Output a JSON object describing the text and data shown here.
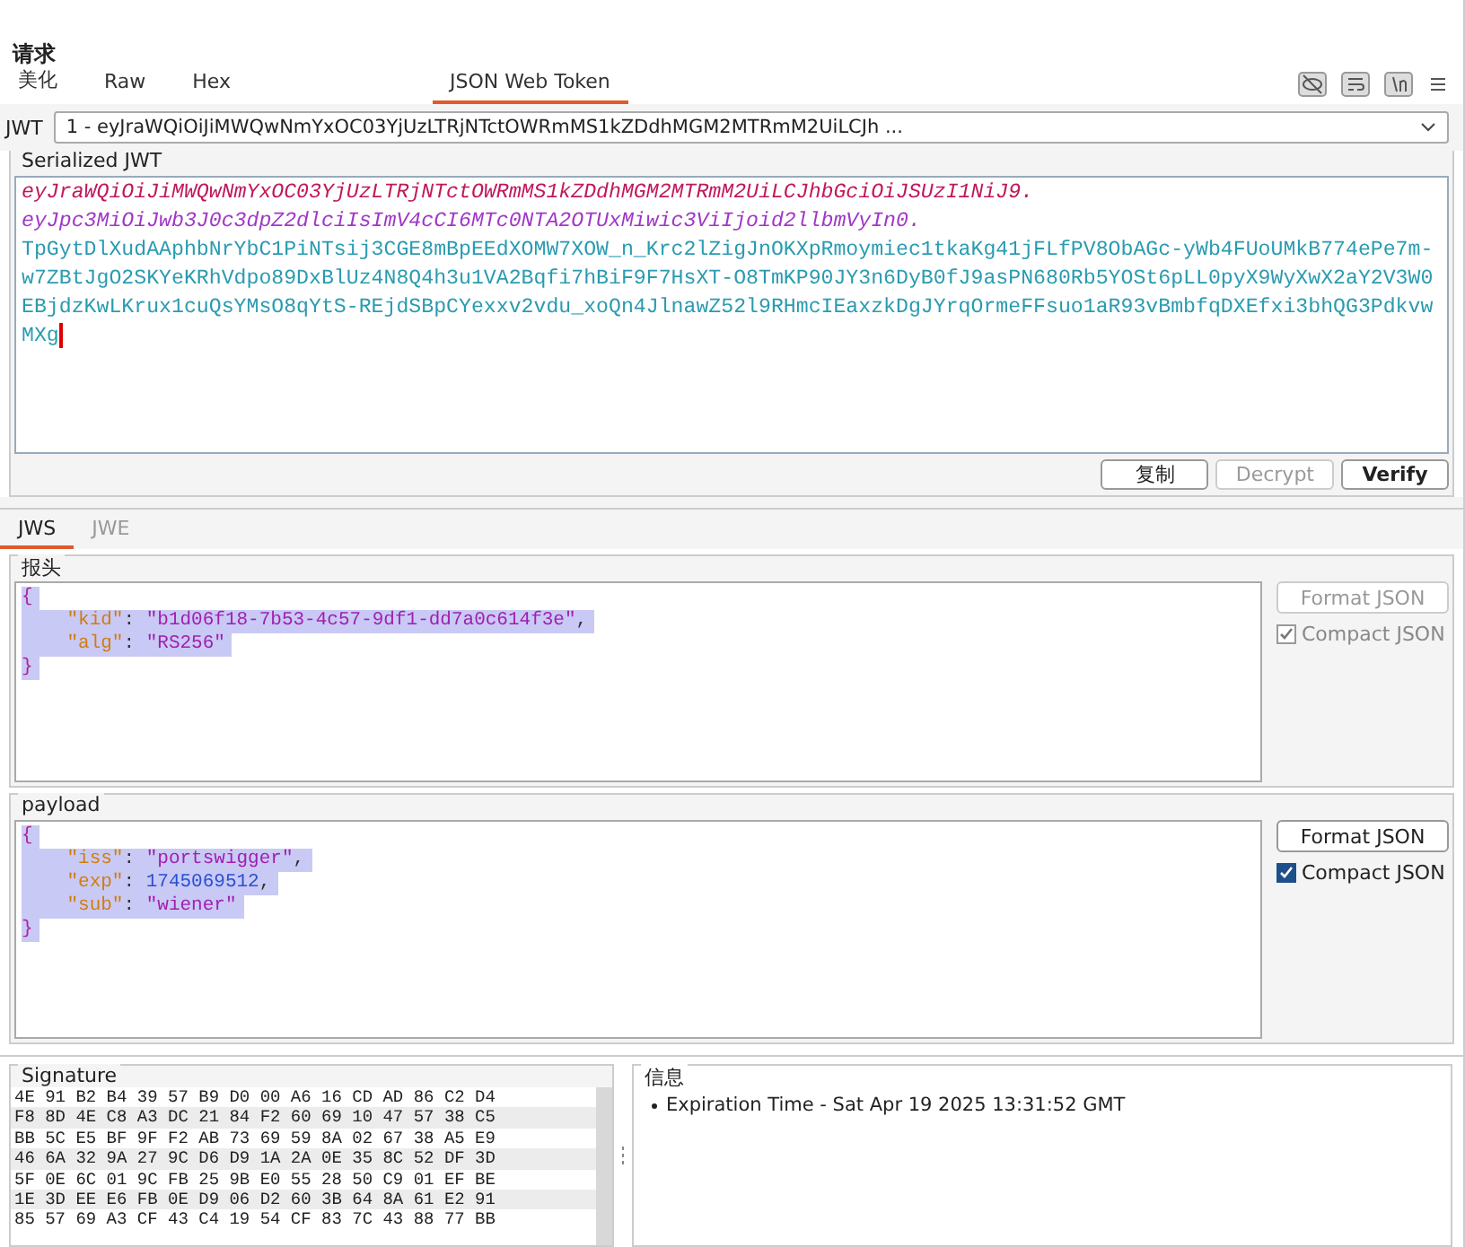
{
  "panel_title": "请求",
  "view_tabs": [
    {
      "label": "美化",
      "selected": false
    },
    {
      "label": "Raw",
      "selected": false
    },
    {
      "label": "Hex",
      "selected": false
    },
    {
      "label": "JSON Web Token",
      "selected": true
    }
  ],
  "jwt_select": {
    "label": "JWT",
    "value": "1 - eyJraWQiOiJiMWQwNmYxOC03YjUzLTRjNTctOWRmMS1kZDdhMGM2MTRmM2UiLCJh ..."
  },
  "serialized": {
    "title": "Serialized JWT",
    "parts": [
      {
        "kind": "header",
        "text": "eyJraWQiOiJiMWQwNmYxOC03YjUzLTRjNTctOWRmMS1kZDdhMGM2MTRmM2UiLCJhbGciOiJSUzI1NiJ9."
      },
      {
        "kind": "payload",
        "text": "eyJpc3MiOiJwb3J0c3dpZ2dlciIsImV4cCI6MTc0NTA2OTUxMiwic3ViIjoid2llbmVyIn0."
      },
      {
        "kind": "signature",
        "text": "TpGytDlXudAAphbNrYbC1PiNTsij3CGE8mBpEEdXOMW7XOW_n_Krc2lZigJnOKXpRmoymiec1tkaKg41jFLfPV8ObAGc-yWb4FUoUMkB774ePe7m-w7ZBtJgO2SKYeKRhVdpo89DxBlUz4N8Q4h3u1VA2Bqfi7hBiF9F7HsXT-O8TmKP90JY3n6DyB0fJ9asPN680Rb5YOSt6pLL0pyX9WyXwX2aY2V3W0EBjdzKwLKrux1cuQsYMsO8qYtS-REjdSBpCYexxv2vdu_xoQn4JlnawZ52l9RHmcIEaxzkDgJYrqOrmeFFsuo1aR93vBmbfqDXEfxi3bhQG3PdkvwMXg"
      }
    ],
    "buttons": [
      {
        "label": "复制",
        "disabled": false
      },
      {
        "label": "Decrypt",
        "disabled": true
      },
      {
        "label": "Verify",
        "disabled": false
      }
    ]
  },
  "token_tabs": [
    {
      "label": "JWS",
      "selected": true
    },
    {
      "label": "JWE",
      "selected": false
    }
  ],
  "sections": [
    {
      "title": "报头",
      "selected": true,
      "lines": [
        {
          "kind": "brace",
          "text": "{"
        },
        {
          "kind": "string",
          "key": "\"kid\"",
          "colon": ": ",
          "value": "\"b1d06f18-7b53-4c57-9df1-dd7a0c614f3e\"",
          "comma": ","
        },
        {
          "kind": "string",
          "key": "\"alg\"",
          "colon": ": ",
          "value": "\"RS256\""
        },
        {
          "kind": "brace",
          "text": "}"
        }
      ],
      "format_button": {
        "label": "Format JSON",
        "disabled": true
      },
      "compact": {
        "label": "Compact JSON",
        "checked": true,
        "disabled": true
      }
    },
    {
      "title": "payload",
      "selected": true,
      "lines": [
        {
          "kind": "brace",
          "text": "{"
        },
        {
          "kind": "string",
          "key": "\"iss\"",
          "colon": ": ",
          "value": "\"portswigger\"",
          "comma": ","
        },
        {
          "kind": "number",
          "key": "\"exp\"",
          "colon": ": ",
          "value": "1745069512",
          "comma": ","
        },
        {
          "kind": "string",
          "key": "\"sub\"",
          "colon": ": ",
          "value": "\"wiener\""
        },
        {
          "kind": "brace",
          "text": "}"
        }
      ],
      "format_button": {
        "label": "Format JSON",
        "disabled": false
      },
      "compact": {
        "label": "Compact JSON",
        "checked": true,
        "disabled": false
      }
    }
  ],
  "signature": {
    "title": "Signature",
    "rows": [
      "4E 91 B2 B4 39 57 B9 D0 00 A6 16 CD AD 86 C2 D4",
      "F8 8D 4E C8 A3 DC 21 84 F2 60 69 10 47 57 38 C5",
      "BB 5C E5 BF 9F F2 AB 73 69 59 8A 02 67 38 A5 E9",
      "46 6A 32 9A 27 9C D6 D9 1A 2A 0E 35 8C 52 DF 3D",
      "5F 0E 6C 01 9C FB 25 9B E0 55 28 50 C9 01 EF BE",
      "1E 3D EE E6 FB 0E D9 06 D2 60 3B 64 8A 61 E2 91",
      "85 57 69 A3 CF 43 C4 19 54 CF 83 7C 43 88 77 BB"
    ]
  },
  "info": {
    "title": "信息",
    "items": [
      "Expiration Time - Sat Apr 19 2025 13:31:52 GMT"
    ]
  }
}
